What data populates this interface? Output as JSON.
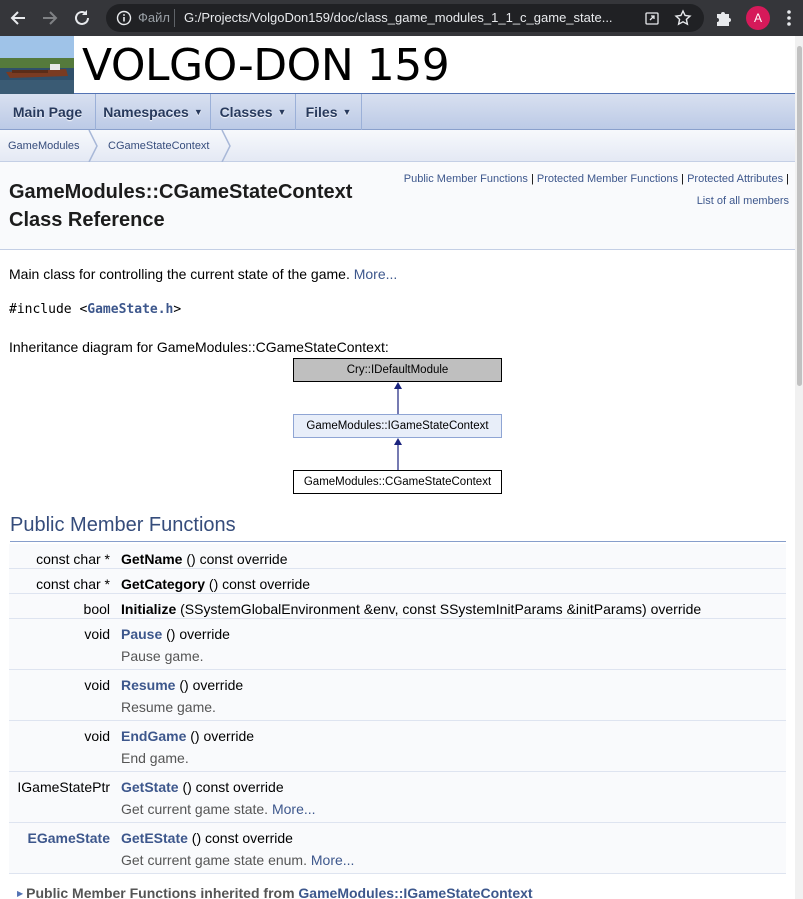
{
  "browser": {
    "file_label": "Файл",
    "url": "G:/Projects/VolgoDon159/doc/class_game_modules_1_1_c_game_state...",
    "profile_initial": "A"
  },
  "project": {
    "name": "VOLGO-DON 159"
  },
  "navbar": {
    "tabs": [
      {
        "label": "Main Page"
      },
      {
        "label": "Namespaces"
      },
      {
        "label": "Classes"
      },
      {
        "label": "Files"
      }
    ]
  },
  "breadcrumb": {
    "items": [
      {
        "label": "GameModules"
      },
      {
        "label": "CGameStateContext"
      }
    ]
  },
  "summary": {
    "public_member_functions": "Public Member Functions",
    "protected_member_functions": "Protected Member Functions",
    "protected_attributes": "Protected Attributes",
    "list_of_all_members": "List of all members",
    "separator": "|"
  },
  "title": {
    "line1": "GameModules::CGameStateContext",
    "line2": "Class Reference"
  },
  "brief": {
    "text": "Main class for controlling the current state of the game.",
    "more": "More..."
  },
  "include": {
    "prefix": "#include <",
    "file": "GameState.h",
    "suffix": ">"
  },
  "inheritance": {
    "label": "Inheritance diagram for GameModules::CGameStateContext:",
    "nodes": [
      {
        "label": "Cry::IDefaultModule"
      },
      {
        "label": "GameModules::IGameStateContext"
      },
      {
        "label": "GameModules::CGameStateContext"
      }
    ]
  },
  "section": {
    "title": "Public Member Functions"
  },
  "members": [
    {
      "type": "const char *",
      "name": "GetName",
      "args": " () const override",
      "desc": "",
      "more": ""
    },
    {
      "type": "const char *",
      "name": "GetCategory",
      "args": " () const override",
      "desc": "",
      "more": ""
    },
    {
      "type": "bool",
      "name": "Initialize",
      "args": " (SSystemGlobalEnvironment &env, const SSystemInitParams &initParams) override",
      "desc": "",
      "more": ""
    },
    {
      "type": "void",
      "name": "Pause",
      "args": " () override",
      "desc": "Pause game.",
      "more": ""
    },
    {
      "type": "void",
      "name": "Resume",
      "args": " () override",
      "desc": "Resume game.",
      "more": ""
    },
    {
      "type": "void",
      "name": "EndGame",
      "args": " () override",
      "desc": "End game.",
      "more": ""
    },
    {
      "type": "IGameStatePtr",
      "name": "GetState",
      "args": " () const override",
      "desc": "Get current game state.",
      "more": "More..."
    },
    {
      "type": "EGameState",
      "name": "GetEState",
      "args": " () const override",
      "desc": "Get current game state enum.",
      "more": "More..."
    }
  ],
  "inherited": {
    "prefix": "Public Member Functions inherited from ",
    "link": "GameModules::IGameStateContext"
  },
  "colors": {
    "link": "#3d578c",
    "header_bg": "#f9fafc",
    "nav_text": "#283a5d",
    "chrome_bg": "#35363a"
  }
}
